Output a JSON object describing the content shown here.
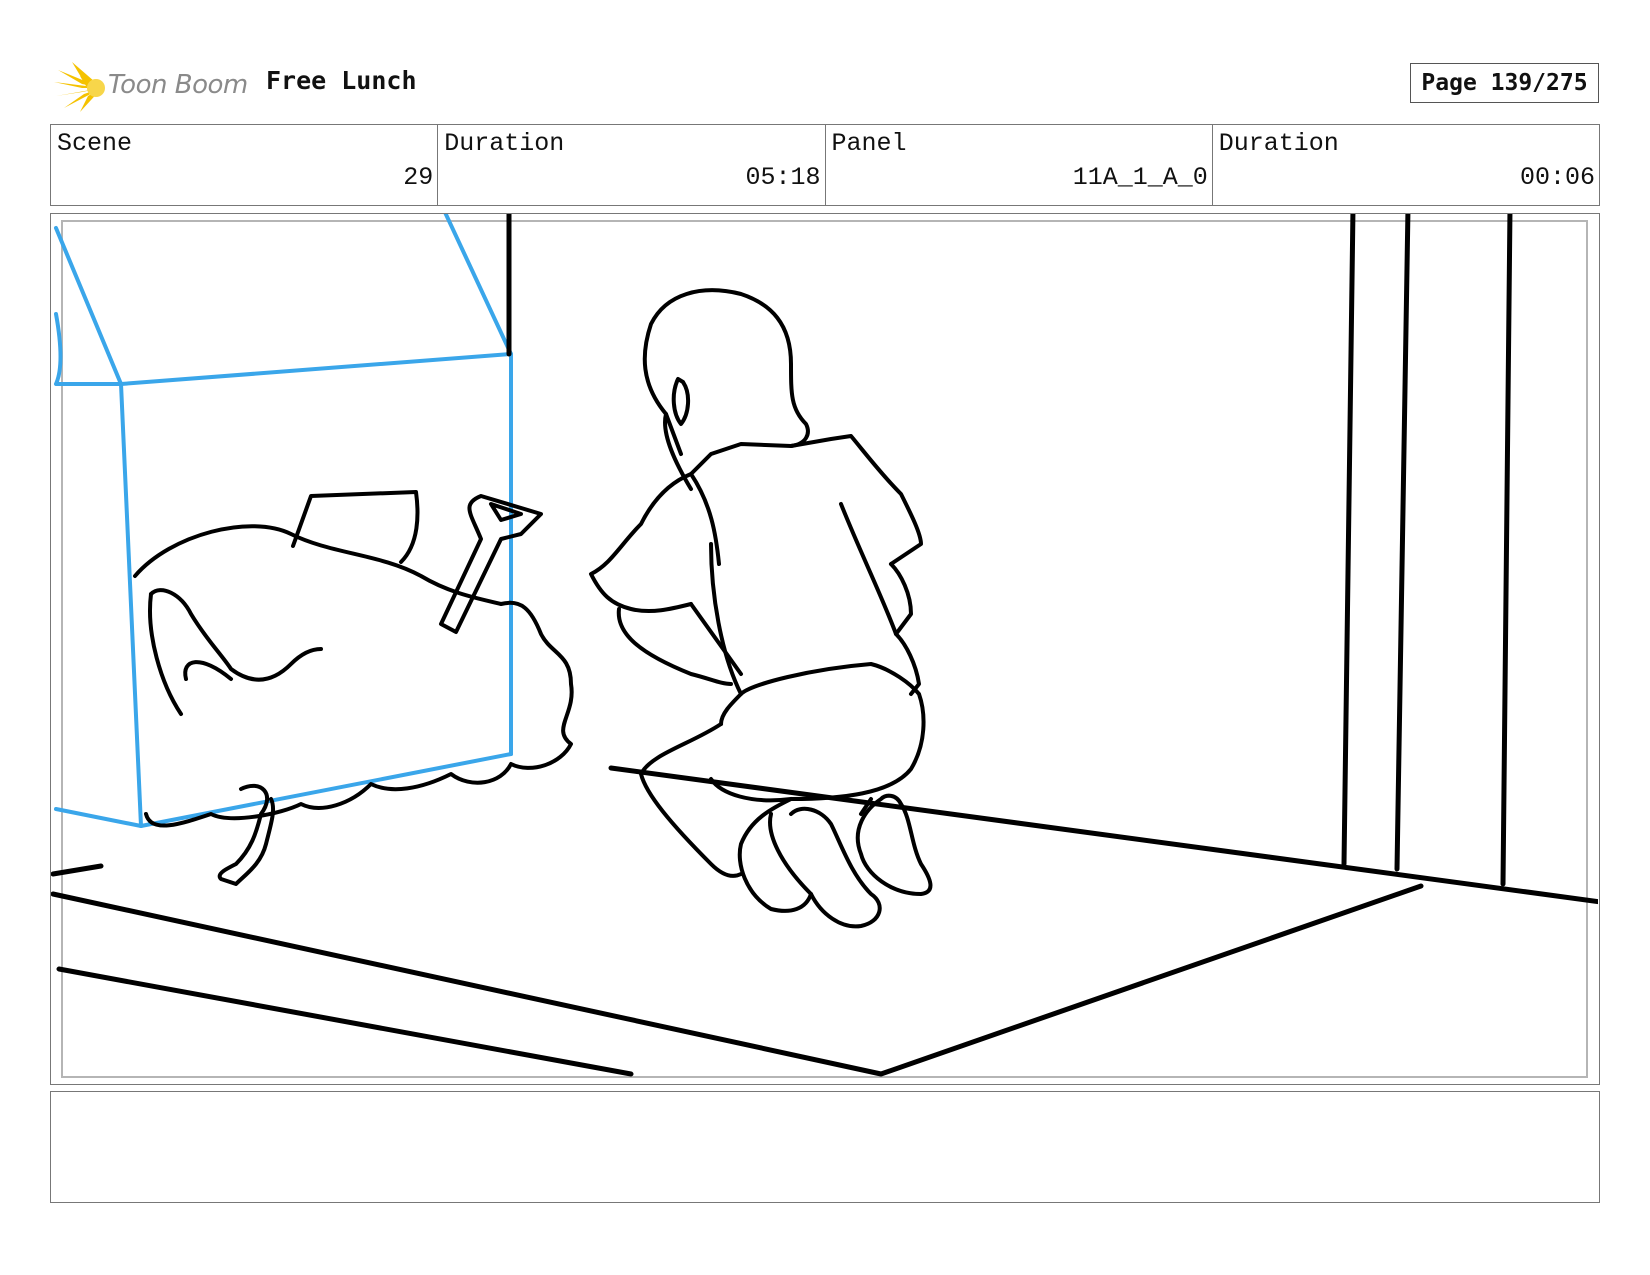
{
  "header": {
    "logo_text": "Toon Boom",
    "project_title": "Free Lunch",
    "page_label": "Page 139/275"
  },
  "info": {
    "scene_label": "Scene",
    "scene_value": "29",
    "scene_duration_label": "Duration",
    "scene_duration_value": "05:18",
    "panel_label": "Panel",
    "panel_value": "11A_1_A_0",
    "panel_duration_label": "Duration",
    "panel_duration_value": "00:06"
  },
  "colors": {
    "logo_accent": "#f5c200",
    "guide_blue": "#3aa6ea",
    "ink": "#000000"
  },
  "notes": ""
}
